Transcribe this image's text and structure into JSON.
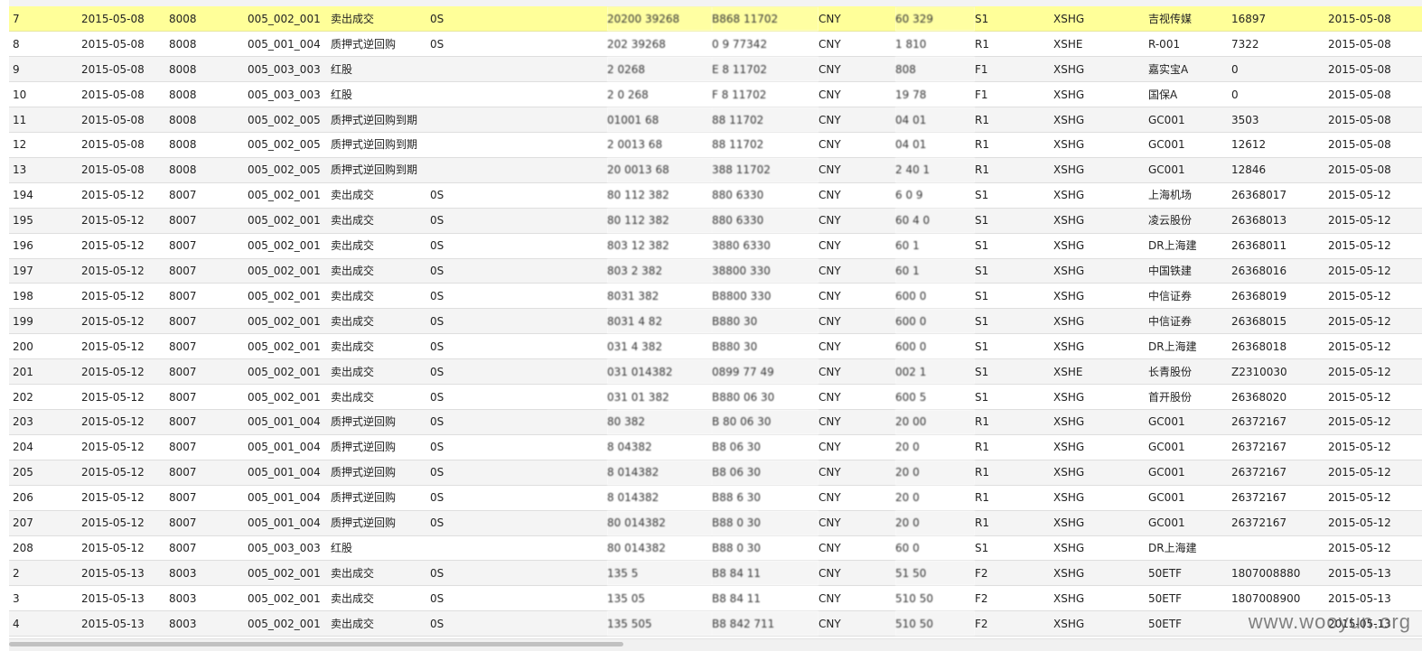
{
  "rows": [
    [
      "7",
      "2015-05-08",
      "8008",
      "005_002_001",
      "卖出成交",
      "0S",
      "20200 39268",
      "B868 11702",
      "CNY",
      "60 329",
      "S1",
      "XSHG",
      "吉视传媒",
      "16897",
      "2015-05-08"
    ],
    [
      "8",
      "2015-05-08",
      "8008",
      "005_001_004",
      "质押式逆回购",
      "0S",
      "202 39268",
      "0 9 77342",
      "CNY",
      "1 810",
      "R1",
      "XSHE",
      "R-001",
      "7322",
      "2015-05-08"
    ],
    [
      "9",
      "2015-05-08",
      "8008",
      "005_003_003",
      "红股",
      "",
      "2 0268",
      "E 8 11702",
      "CNY",
      "808",
      "F1",
      "XSHG",
      "嘉实宝A",
      "0",
      "2015-05-08"
    ],
    [
      "10",
      "2015-05-08",
      "8008",
      "005_003_003",
      "红股",
      "",
      "2 0 268",
      "F 8 11702",
      "CNY",
      "19 78",
      "F1",
      "XSHG",
      "国保A",
      "0",
      "2015-05-08"
    ],
    [
      "11",
      "2015-05-08",
      "8008",
      "005_002_005",
      "质押式逆回购到期",
      "",
      "01001 68",
      "88 11702",
      "CNY",
      "04 01",
      "R1",
      "XSHG",
      "GC001",
      "3503",
      "2015-05-08"
    ],
    [
      "12",
      "2015-05-08",
      "8008",
      "005_002_005",
      "质押式逆回购到期",
      "",
      "2 0013 68",
      "88 11702",
      "CNY",
      "04 01",
      "R1",
      "XSHG",
      "GC001",
      "12612",
      "2015-05-08"
    ],
    [
      "13",
      "2015-05-08",
      "8008",
      "005_002_005",
      "质押式逆回购到期",
      "",
      "20 0013 68",
      "388 11702",
      "CNY",
      "2 40 1",
      "R1",
      "XSHG",
      "GC001",
      "12846",
      "2015-05-08"
    ],
    [
      "194",
      "2015-05-12",
      "8007",
      "005_002_001",
      "卖出成交",
      "0S",
      "80 112 382",
      "880 6330",
      "CNY",
      "6 0 9",
      "S1",
      "XSHG",
      "上海机场",
      "26368017",
      "2015-05-12"
    ],
    [
      "195",
      "2015-05-12",
      "8007",
      "005_002_001",
      "卖出成交",
      "0S",
      "80 112 382",
      "880 6330",
      "CNY",
      "60 4 0",
      "S1",
      "XSHG",
      "凌云股份",
      "26368013",
      "2015-05-12"
    ],
    [
      "196",
      "2015-05-12",
      "8007",
      "005_002_001",
      "卖出成交",
      "0S",
      "803 12 382",
      "3880 6330",
      "CNY",
      "60 1",
      "S1",
      "XSHG",
      "DR上海建",
      "26368011",
      "2015-05-12"
    ],
    [
      "197",
      "2015-05-12",
      "8007",
      "005_002_001",
      "卖出成交",
      "0S",
      "803 2 382",
      "38800 330",
      "CNY",
      "60 1",
      "S1",
      "XSHG",
      "中国铁建",
      "26368016",
      "2015-05-12"
    ],
    [
      "198",
      "2015-05-12",
      "8007",
      "005_002_001",
      "卖出成交",
      "0S",
      "8031 382",
      "B8800 330",
      "CNY",
      "600 0",
      "S1",
      "XSHG",
      "中信证券",
      "26368019",
      "2015-05-12"
    ],
    [
      "199",
      "2015-05-12",
      "8007",
      "005_002_001",
      "卖出成交",
      "0S",
      "8031 4 82",
      "B880 30",
      "CNY",
      "600 0",
      "S1",
      "XSHG",
      "中信证券",
      "26368015",
      "2015-05-12"
    ],
    [
      "200",
      "2015-05-12",
      "8007",
      "005_002_001",
      "卖出成交",
      "0S",
      "031 4 382",
      "B880 30",
      "CNY",
      "600 0",
      "S1",
      "XSHG",
      "DR上海建",
      "26368018",
      "2015-05-12"
    ],
    [
      "201",
      "2015-05-12",
      "8007",
      "005_002_001",
      "卖出成交",
      "0S",
      "031 014382",
      "0899 77 49",
      "CNY",
      "002 1",
      "S1",
      "XSHE",
      "长青股份",
      "Z2310030",
      "2015-05-12"
    ],
    [
      "202",
      "2015-05-12",
      "8007",
      "005_002_001",
      "卖出成交",
      "0S",
      "031 01 382",
      "B880 06 30",
      "CNY",
      "600 5",
      "S1",
      "XSHG",
      "首开股份",
      "26368020",
      "2015-05-12"
    ],
    [
      "203",
      "2015-05-12",
      "8007",
      "005_001_004",
      "质押式逆回购",
      "0S",
      "80 382",
      "B 80 06 30",
      "CNY",
      "20 00",
      "R1",
      "XSHG",
      "GC001",
      "26372167",
      "2015-05-12"
    ],
    [
      "204",
      "2015-05-12",
      "8007",
      "005_001_004",
      "质押式逆回购",
      "0S",
      "8 04382",
      "B8 06 30",
      "CNY",
      "20 0",
      "R1",
      "XSHG",
      "GC001",
      "26372167",
      "2015-05-12"
    ],
    [
      "205",
      "2015-05-12",
      "8007",
      "005_001_004",
      "质押式逆回购",
      "0S",
      "8 014382",
      "B8 06 30",
      "CNY",
      "20 0",
      "R1",
      "XSHG",
      "GC001",
      "26372167",
      "2015-05-12"
    ],
    [
      "206",
      "2015-05-12",
      "8007",
      "005_001_004",
      "质押式逆回购",
      "0S",
      "8 014382",
      "B88 6 30",
      "CNY",
      "20 0",
      "R1",
      "XSHG",
      "GC001",
      "26372167",
      "2015-05-12"
    ],
    [
      "207",
      "2015-05-12",
      "8007",
      "005_001_004",
      "质押式逆回购",
      "0S",
      "80 014382",
      "B88 0 30",
      "CNY",
      "20 0",
      "R1",
      "XSHG",
      "GC001",
      "26372167",
      "2015-05-12"
    ],
    [
      "208",
      "2015-05-12",
      "8007",
      "005_003_003",
      "红股",
      "",
      "80 014382",
      "B88 0 30",
      "CNY",
      "60 0",
      "S1",
      "XSHG",
      "DR上海建",
      "",
      "2015-05-12"
    ],
    [
      "2",
      "2015-05-13",
      "8003",
      "005_002_001",
      "卖出成交",
      "0S",
      "135 5",
      "B8 84 11",
      "CNY",
      "51 50",
      "F2",
      "XSHG",
      "50ETF",
      "1807008880",
      "2015-05-13"
    ],
    [
      "3",
      "2015-05-13",
      "8003",
      "005_002_001",
      "卖出成交",
      "0S",
      "135 05",
      "B8 84 11",
      "CNY",
      "510 50",
      "F2",
      "XSHG",
      "50ETF",
      "1807008900",
      "2015-05-13"
    ],
    [
      "4",
      "2015-05-13",
      "8003",
      "005_002_001",
      "卖出成交",
      "0S",
      "135 505",
      "B8 842 711",
      "CNY",
      "510 50",
      "F2",
      "XSHG",
      "50ETF",
      "",
      "2015-05-13"
    ]
  ],
  "selected_row_index": 0,
  "watermark": "www.wooyun.org",
  "colors": {
    "selected_row": "#ffff99",
    "alt_row": "#f4f4f4",
    "row_border": "#dedede"
  }
}
